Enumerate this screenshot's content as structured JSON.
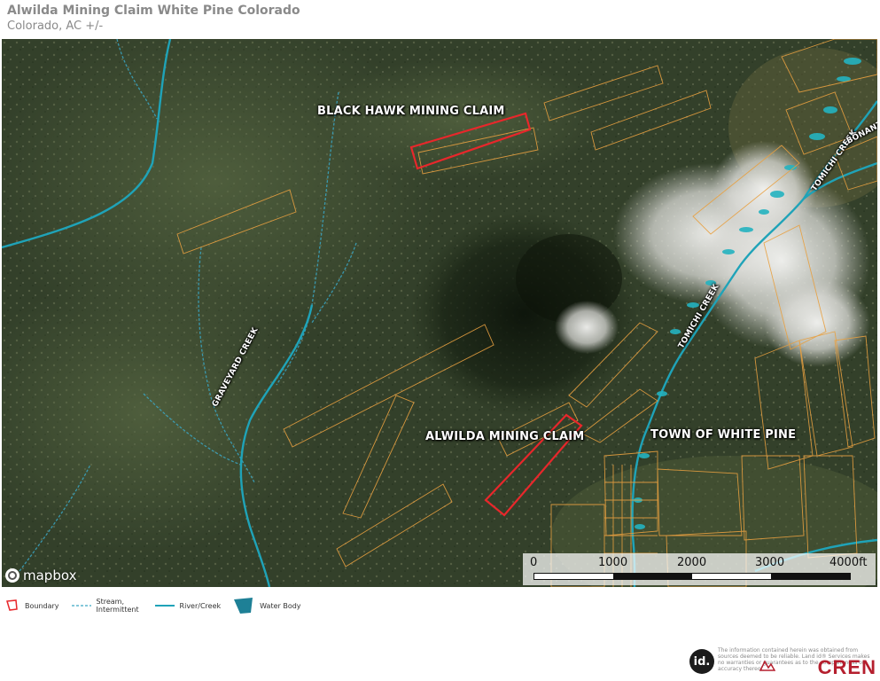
{
  "header": {
    "title": "Alwilda Mining Claim White Pine Colorado",
    "subtitle": "Colorado,  AC +/-"
  },
  "map": {
    "labels": {
      "black_hawk": "BLACK HAWK MINING CLAIM",
      "alwilda": "ALWILDA MINING CLAIM",
      "town": "TOWN OF WHITE PINE",
      "graveyard_creek": "GRAVEYARD CREEK",
      "tomichi_creek_lower": "TOMICHI CREEK",
      "tomichi_creek_upper": "TOMICHI CREEK",
      "bonanza": "BONANZA"
    },
    "attribution": "mapbox",
    "colors": {
      "claim_boundary": "#e8272b",
      "parcel_lines": "#e8a040",
      "river": "#1fa3b8",
      "stream": "#3aa6c4",
      "water_body": "#1e8096"
    }
  },
  "scale_bar": {
    "ticks": [
      "0",
      "1000",
      "2000",
      "3000",
      "4000ft"
    ]
  },
  "legend": {
    "items": [
      {
        "label": "Boundary",
        "icon": "boundary-icon"
      },
      {
        "label": "Stream, Intermittent",
        "icon": "stream-icon"
      },
      {
        "label": "River/Creek",
        "icon": "river-icon"
      },
      {
        "label": "Water Body",
        "icon": "water-body-icon"
      }
    ]
  },
  "footer": {
    "id_logo": "id.",
    "disclaimer": "The information contained herein was obtained from sources deemed to be reliable. Land id® Services makes no warranties or guarantees as to the completeness or accuracy thereof.",
    "brand": "CREN"
  }
}
